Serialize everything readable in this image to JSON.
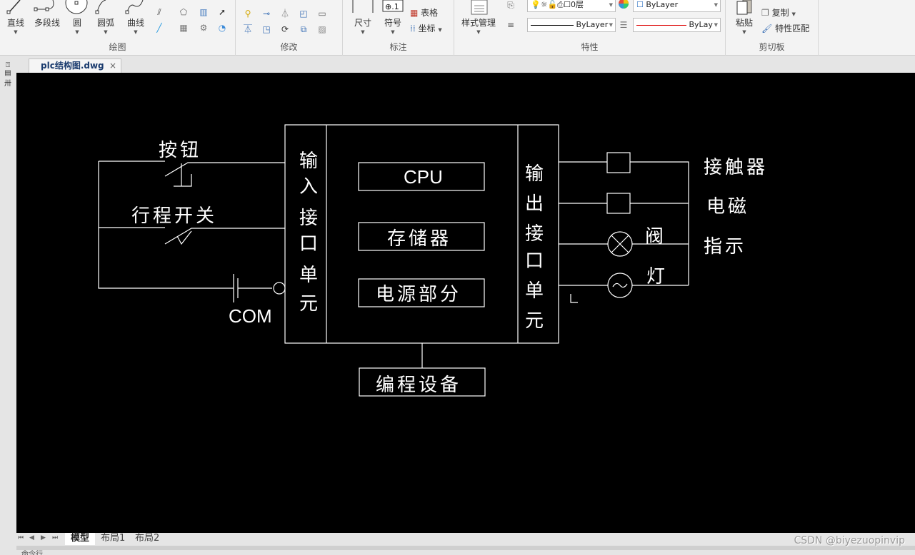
{
  "ribbon": {
    "draw": {
      "title": "绘图",
      "buttons": [
        {
          "label": "直线",
          "icon": "line-icon"
        },
        {
          "label": "多段线",
          "icon": "polyline-icon"
        },
        {
          "label": "圆",
          "icon": "circle-icon"
        },
        {
          "label": "圆弧",
          "icon": "arc-icon"
        },
        {
          "label": "曲线",
          "icon": "spline-icon"
        }
      ]
    },
    "modify": {
      "title": "修改"
    },
    "annotate": {
      "title": "标注",
      "buttons": [
        {
          "label": "尺寸",
          "icon": "dimension-icon"
        },
        {
          "label": "符号",
          "icon": "symbol-icon"
        }
      ],
      "small": [
        {
          "label": "表格",
          "icon": "table-icon"
        },
        {
          "label": "坐标",
          "icon": "coordinate-icon"
        }
      ]
    },
    "properties": {
      "title": "特性",
      "style_button": "样式管理",
      "layer_value": "0层",
      "color_value": "ByLayer",
      "linetype_value": "ByLayer",
      "lineweight_value": "ByLay"
    },
    "clipboard": {
      "title": "剪切板",
      "paste": "粘贴",
      "copy": "复制",
      "match": "特性匹配"
    }
  },
  "doc_tab": {
    "title": "plc结构图.dwg",
    "close": "×"
  },
  "drawing": {
    "inputs": {
      "button_label": "按钮",
      "limit_switch_label": "行程开关",
      "com_label": "COM"
    },
    "plc": {
      "input_unit": [
        "输",
        "入",
        "接",
        "口",
        "单",
        "元"
      ],
      "output_unit": [
        "输",
        "出",
        "接",
        "口",
        "单",
        "元"
      ],
      "cpu": "CPU",
      "memory": "存储器",
      "power": "电源部分",
      "programmer": "编程设备"
    },
    "outputs": {
      "contactor": "接触器",
      "solenoid_1": "电磁",
      "solenoid_2": "阀",
      "indicator_1": "指示",
      "indicator_2": "灯",
      "l_label": "L"
    }
  },
  "layout_tabs": {
    "tabs": [
      "模型",
      "布局1",
      "布局2"
    ],
    "active": "模型"
  },
  "command_line": "命令行",
  "watermark": "CSDN @biyezuopinvip"
}
